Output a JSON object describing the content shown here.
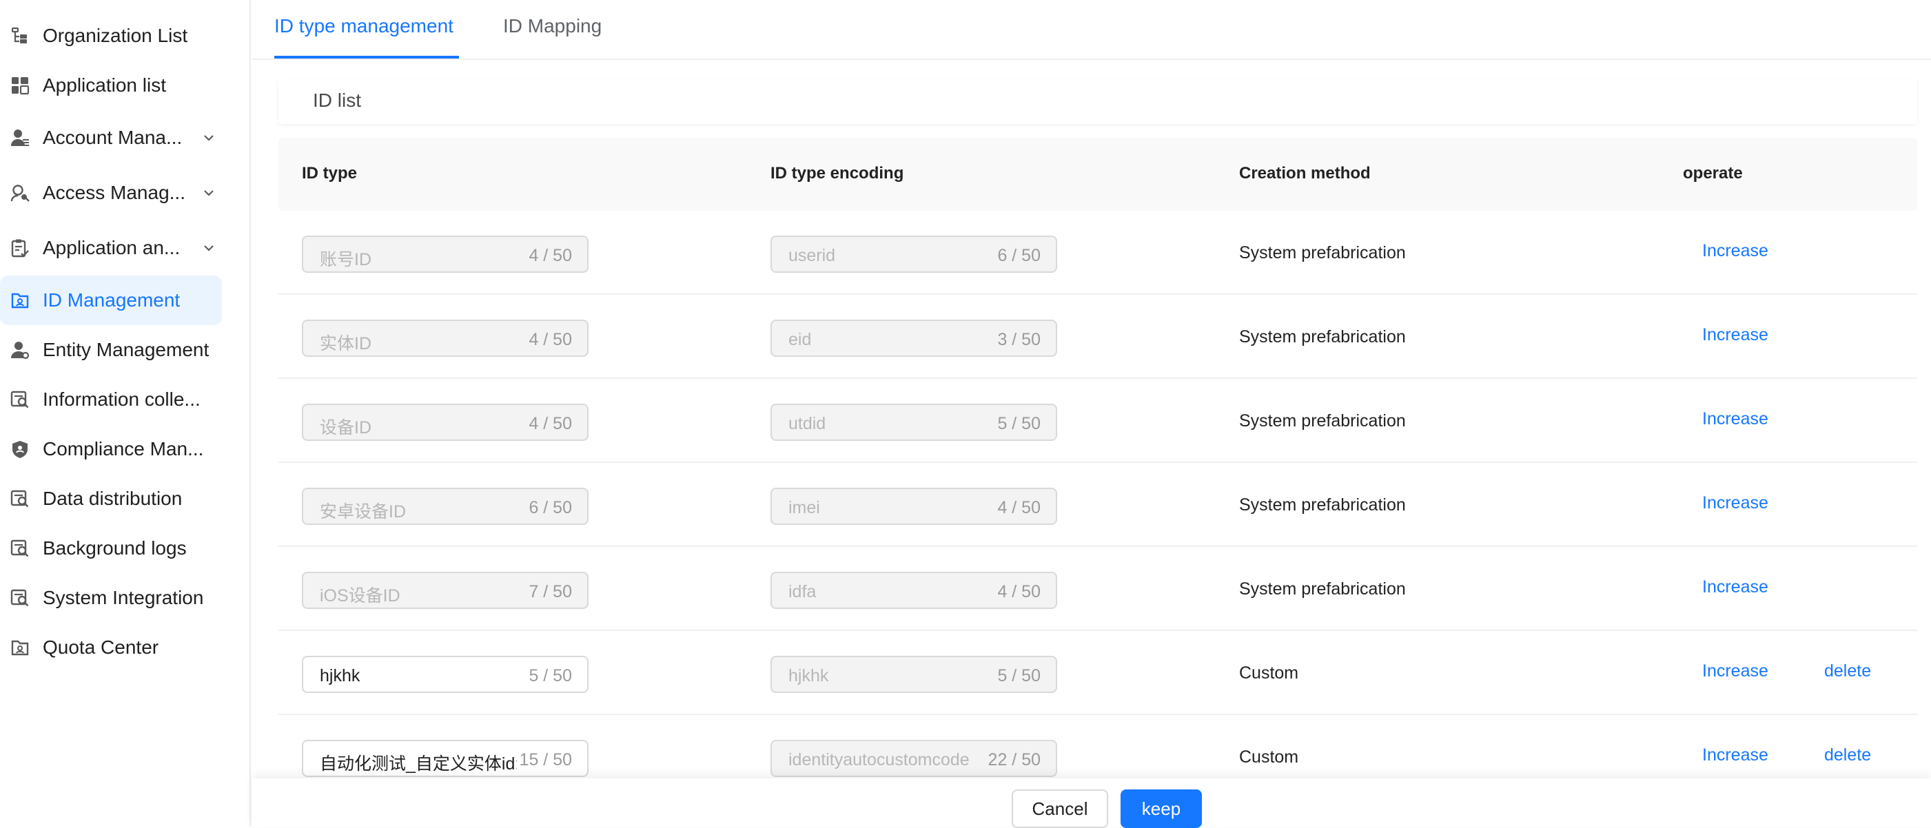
{
  "sidebar": {
    "items": [
      {
        "label": "Organization List",
        "icon": "org-tree-icon",
        "expandable": false,
        "active": false
      },
      {
        "label": "Application list",
        "icon": "grid-apps-icon",
        "expandable": false,
        "active": false
      },
      {
        "label": "Account Mana...",
        "icon": "user-account-icon",
        "expandable": true,
        "active": false
      },
      {
        "label": "Access Manag...",
        "icon": "access-key-icon",
        "expandable": true,
        "active": false
      },
      {
        "label": "Application an...",
        "icon": "clipboard-check-icon",
        "expandable": true,
        "active": false
      },
      {
        "label": "ID Management",
        "icon": "id-folder-icon",
        "expandable": false,
        "active": true
      },
      {
        "label": "Entity Management",
        "icon": "entity-user-icon",
        "expandable": false,
        "active": false
      },
      {
        "label": "Information colle...",
        "icon": "search-doc-icon",
        "expandable": false,
        "active": false
      },
      {
        "label": "Compliance Man...",
        "icon": "shield-icon",
        "expandable": false,
        "active": false
      },
      {
        "label": "Data distribution",
        "icon": "search-doc-icon",
        "expandable": false,
        "active": false
      },
      {
        "label": "Background logs",
        "icon": "search-doc-icon",
        "expandable": false,
        "active": false
      },
      {
        "label": "System Integration",
        "icon": "search-doc-icon",
        "expandable": false,
        "active": false
      },
      {
        "label": "Quota Center",
        "icon": "id-folder-icon",
        "expandable": false,
        "active": false
      }
    ]
  },
  "tabs": [
    {
      "label": "ID type management",
      "active": true
    },
    {
      "label": "ID Mapping",
      "active": false
    }
  ],
  "section": {
    "title": "ID list"
  },
  "table": {
    "headers": [
      "ID type",
      "ID type encoding",
      "Creation method",
      "operate"
    ],
    "rows": [
      {
        "id_type": "账号ID",
        "id_type_count": "4 / 50",
        "id_type_editable": false,
        "encoding": "userid",
        "encoding_count": "6 / 50",
        "method": "System prefabrication",
        "increase": "Increase",
        "delete": ""
      },
      {
        "id_type": "实体ID",
        "id_type_count": "4 / 50",
        "id_type_editable": false,
        "encoding": "eid",
        "encoding_count": "3 / 50",
        "method": "System prefabrication",
        "increase": "Increase",
        "delete": ""
      },
      {
        "id_type": "设备ID",
        "id_type_count": "4 / 50",
        "id_type_editable": false,
        "encoding": "utdid",
        "encoding_count": "5 / 50",
        "method": "System prefabrication",
        "increase": "Increase",
        "delete": ""
      },
      {
        "id_type": "安卓设备ID",
        "id_type_count": "6 / 50",
        "id_type_editable": false,
        "encoding": "imei",
        "encoding_count": "4 / 50",
        "method": "System prefabrication",
        "increase": "Increase",
        "delete": ""
      },
      {
        "id_type": "iOS设备ID",
        "id_type_count": "7 / 50",
        "id_type_editable": false,
        "encoding": "idfa",
        "encoding_count": "4 / 50",
        "method": "System prefabrication",
        "increase": "Increase",
        "delete": ""
      },
      {
        "id_type": "hjkhk",
        "id_type_count": "5 / 50",
        "id_type_editable": true,
        "encoding": "hjkhk",
        "encoding_count": "5 / 50",
        "method": "Custom",
        "increase": "Increase",
        "delete": "delete"
      },
      {
        "id_type": "自动化测试_自定义实体id:",
        "id_type_count": "15 / 50",
        "id_type_editable": true,
        "encoding": "identityautocustomcode",
        "encoding_count": "22 / 50",
        "method": "Custom",
        "increase": "Increase",
        "delete": "delete"
      }
    ]
  },
  "footer": {
    "cancel_label": "Cancel",
    "keep_label": "keep"
  },
  "colors": {
    "accent": "#1677ff",
    "active_nav_bg": "#eaf4fe",
    "disabled_field_bg": "#f3f3f3"
  }
}
